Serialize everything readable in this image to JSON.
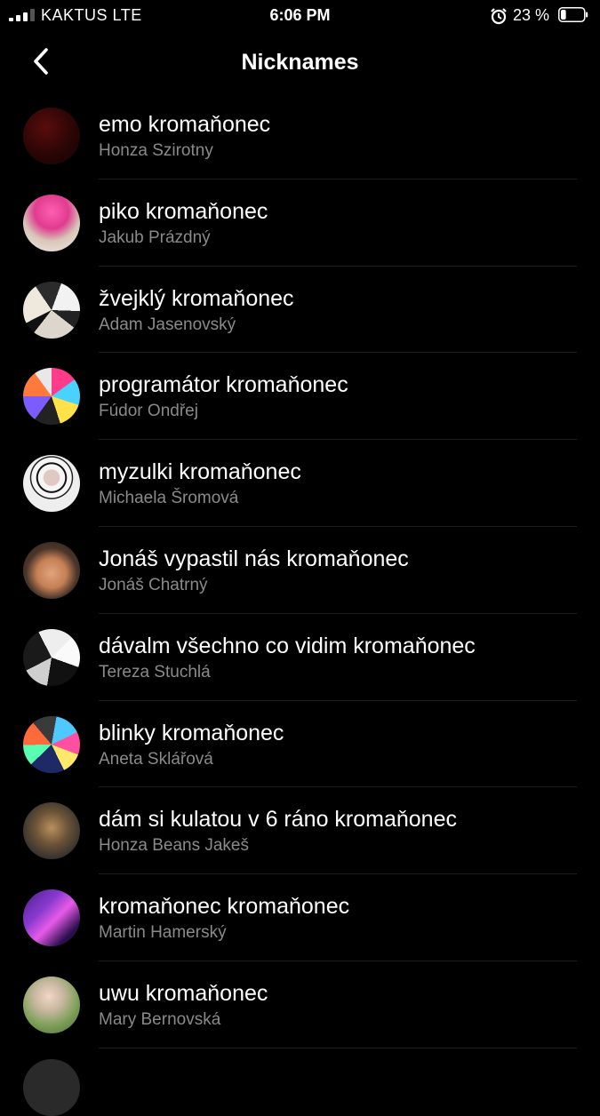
{
  "status_bar": {
    "carrier": "KAKTUS  LTE",
    "time": "6:06 PM",
    "battery": "23 %",
    "battery_level": 0.23
  },
  "nav": {
    "title": "Nicknames"
  },
  "items": [
    {
      "nickname": "emo kromaňonec",
      "name": "Honza Szirotny"
    },
    {
      "nickname": "piko kromaňonec",
      "name": "Jakub Prázdný"
    },
    {
      "nickname": "žvejklý kromaňonec",
      "name": "Adam Jasenovský"
    },
    {
      "nickname": "programátor kromaňonec",
      "name": "Fúdor Ondřej"
    },
    {
      "nickname": "myzulki kromaňonec",
      "name": "Michaela Šromová"
    },
    {
      "nickname": "Jonáš vypastil nás kromaňonec",
      "name": "Jonáš Chatrný"
    },
    {
      "nickname": "dávalm všechno co vidim kromaňonec",
      "name": "Tereza Stuchlá"
    },
    {
      "nickname": "blinky kromaňonec",
      "name": "Aneta Sklářová"
    },
    {
      "nickname": "dám si kulatou v 6 ráno kromaňonec",
      "name": "Honza Beans Jakeš"
    },
    {
      "nickname": "kromaňonec kromaňonec",
      "name": "Martin Hamerský"
    },
    {
      "nickname": "uwu kromaňonec",
      "name": "Mary Bernovská"
    }
  ]
}
